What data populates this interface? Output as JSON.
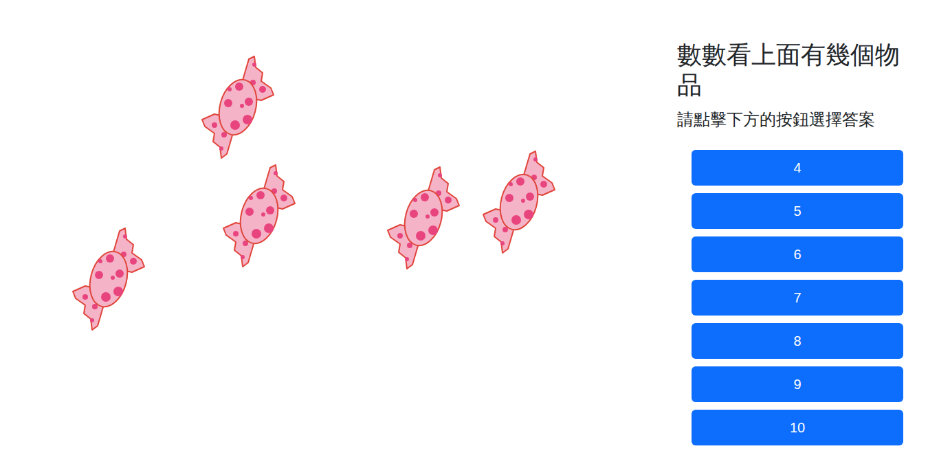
{
  "question": {
    "title": "數數看上面有幾個物品",
    "subtitle": "請點擊下方的按鈕選擇答案"
  },
  "items": [
    {
      "kind": "candy"
    },
    {
      "kind": "candy"
    },
    {
      "kind": "candy"
    },
    {
      "kind": "candy"
    },
    {
      "kind": "candy"
    }
  ],
  "answers": [
    {
      "label": "4"
    },
    {
      "label": "5"
    },
    {
      "label": "6"
    },
    {
      "label": "7"
    },
    {
      "label": "8"
    },
    {
      "label": "9"
    },
    {
      "label": "10"
    }
  ]
}
